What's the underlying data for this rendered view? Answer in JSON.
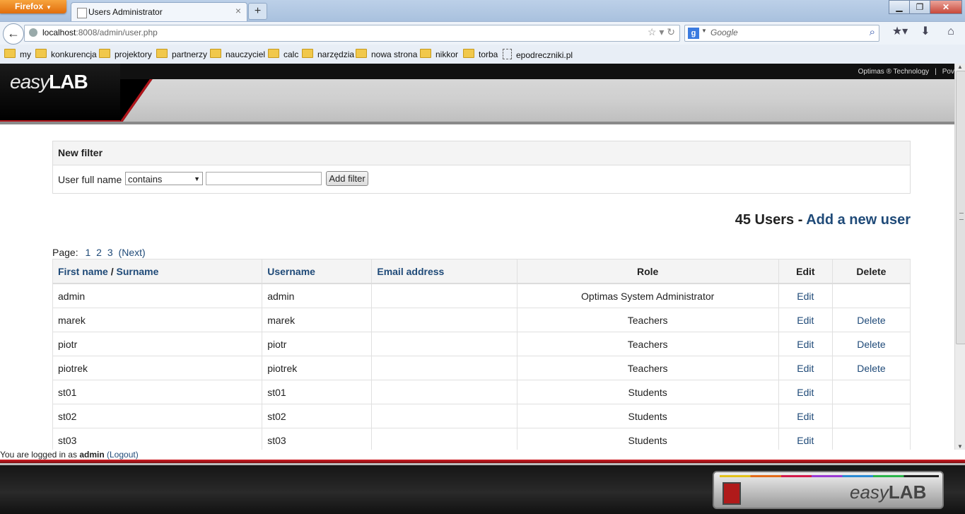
{
  "browser": {
    "menu_button": "Firefox",
    "tab_title": "Users Administrator",
    "url_host": "localhost",
    "url_rest": ":8008/admin/user.php",
    "search_placeholder": "Google",
    "bookmarks": [
      "my",
      "konkurencja",
      "projektory",
      "partnerzy",
      "nauczyciel",
      "calc",
      "narzędzia",
      "nowa strona",
      "nikkor",
      "torba",
      "epodreczniki.pl"
    ]
  },
  "header": {
    "logo_easy": "easy",
    "logo_lab": "LAB",
    "toplink_1": "Optimas ® Technology",
    "toplink_2": "Pov"
  },
  "filter": {
    "title": "New filter",
    "field_label": "User full name",
    "operator": "contains",
    "value": "",
    "button": "Add filter"
  },
  "summary": {
    "count_text": "45 Users -",
    "add_link": "Add a new user"
  },
  "pager": {
    "label": "Page:",
    "pages": [
      "1",
      "2",
      "3"
    ],
    "next": "(Next)"
  },
  "table": {
    "headers": {
      "first_name": "First name",
      "slash": "/",
      "surname": "Surname",
      "username": "Username",
      "email": "Email address",
      "role": "Role",
      "edit": "Edit",
      "delete": "Delete"
    },
    "rows": [
      {
        "name": "admin",
        "username": "admin",
        "email": "",
        "role": "Optimas System Administrator",
        "edit": "Edit",
        "delete": ""
      },
      {
        "name": "marek",
        "username": "marek",
        "email": "",
        "role": "Teachers",
        "edit": "Edit",
        "delete": "Delete"
      },
      {
        "name": "piotr",
        "username": "piotr",
        "email": "",
        "role": "Teachers",
        "edit": "Edit",
        "delete": "Delete"
      },
      {
        "name": "piotrek",
        "username": "piotrek",
        "email": "",
        "role": "Teachers",
        "edit": "Edit",
        "delete": "Delete"
      },
      {
        "name": "st01",
        "username": "st01",
        "email": "",
        "role": "Students",
        "edit": "Edit",
        "delete": ""
      },
      {
        "name": "st02",
        "username": "st02",
        "email": "",
        "role": "Students",
        "edit": "Edit",
        "delete": ""
      },
      {
        "name": "st03",
        "username": "st03",
        "email": "",
        "role": "Students",
        "edit": "Edit",
        "delete": ""
      }
    ]
  },
  "footer": {
    "login_prefix": "You are logged in as",
    "login_user": "admin",
    "logout": "(Logout)",
    "logo_easy": "easy",
    "logo_lab": "LAB"
  }
}
